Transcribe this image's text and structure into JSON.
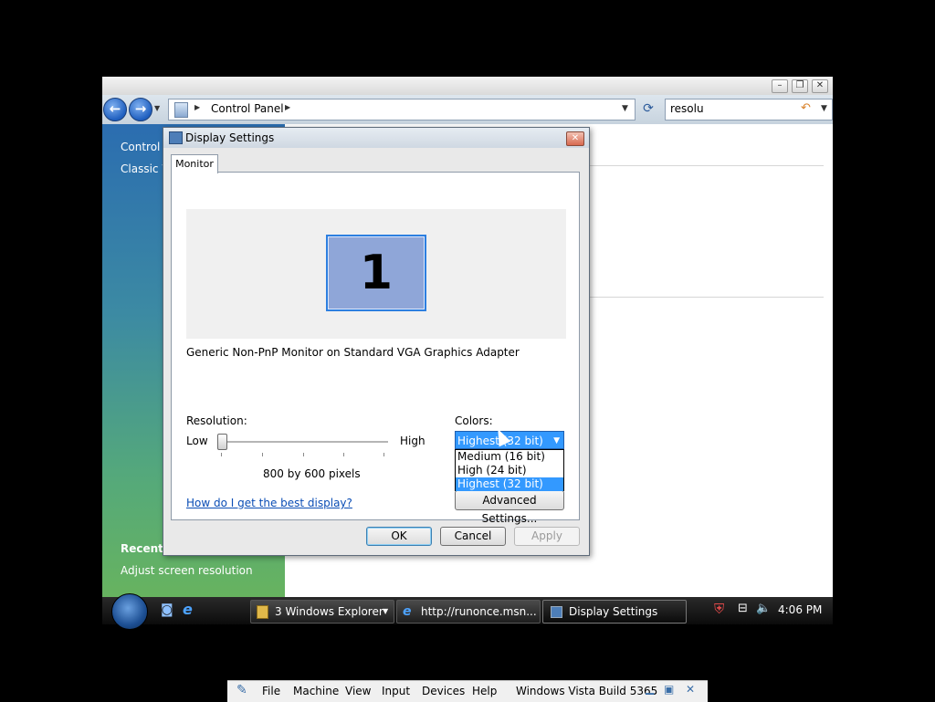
{
  "explorer": {
    "breadcrumb": [
      "Control Panel"
    ],
    "search_value": "resolu",
    "left_links": [
      "Control I",
      "Classic V"
    ],
    "recent_title": "Recent T",
    "recent_task": "Adjust screen resolution"
  },
  "dialog": {
    "title": "Display Settings",
    "tab": "Monitor",
    "monitor_number": "1",
    "monitor_name": "Generic Non-PnP Monitor on Standard VGA Graphics Adapter",
    "resolution_label": "Resolution:",
    "low_label": "Low",
    "high_label": "High",
    "resolution_value": "800 by 600 pixels",
    "help_link": "How do I get the best display?",
    "colors_label": "Colors:",
    "colors_selected": "Highest (32 bit)",
    "colors_options": [
      "Medium (16 bit)",
      "High (24 bit)",
      "Highest (32 bit)"
    ],
    "advanced_button": "Advanced Settings...",
    "ok": "OK",
    "cancel": "Cancel",
    "apply": "Apply"
  },
  "taskbar": {
    "buttons": [
      "3 Windows Explorer",
      "http://runonce.msn...",
      "Display Settings"
    ],
    "clock": "4:06 PM"
  },
  "vm_toolbar": {
    "menus": [
      "File",
      "Machine",
      "View",
      "Input",
      "Devices",
      "Help"
    ],
    "title": "Windows Vista Build 5365"
  }
}
